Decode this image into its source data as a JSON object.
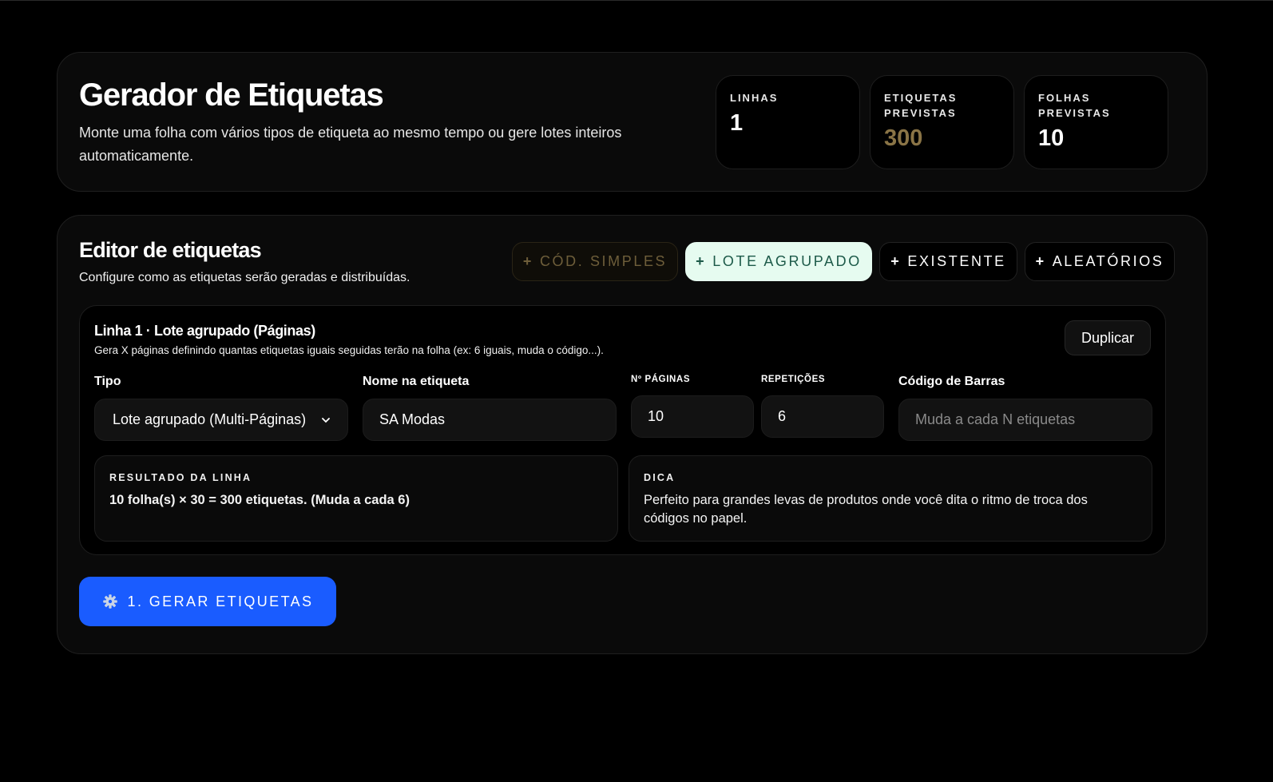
{
  "header": {
    "title": "Gerador de Etiquetas",
    "subtitle": "Monte uma folha com vários tipos de etiqueta ao mesmo tempo ou gere lotes inteiros automaticamente.",
    "stats": [
      {
        "label": "LINHAS",
        "value": "1"
      },
      {
        "label": "ETIQUETAS PREVISTAS",
        "value": "300",
        "color": "#8a7446"
      },
      {
        "label": "FOLHAS PREVISTAS",
        "value": "10"
      }
    ]
  },
  "editor": {
    "title": "Editor de etiquetas",
    "subtitle": "Configure como as etiquetas serão geradas e distribuídas.",
    "add_buttons": [
      {
        "plus": "+",
        "label": "CÓD. SIMPLES",
        "state": "muted"
      },
      {
        "plus": "+",
        "label": "LOTE AGRUPADO",
        "state": "active"
      },
      {
        "plus": "+",
        "label": "EXISTENTE",
        "state": "default"
      },
      {
        "plus": "+",
        "label": "ALEATÓRIOS",
        "state": "default"
      }
    ],
    "line": {
      "title": "Linha 1 · Lote agrupado (Páginas)",
      "description": "Gera X páginas definindo quantas etiquetas iguais seguidas terão na folha (ex: 6 iguais, muda o código...).",
      "duplicate_label": "Duplicar",
      "fields": {
        "tipo": {
          "label": "Tipo",
          "value": "Lote agrupado (Multi-Páginas)"
        },
        "nome": {
          "label": "Nome na etiqueta",
          "value": "SA Modas"
        },
        "paginas": {
          "label": "Nº PÁGINAS",
          "value": "10"
        },
        "repeticoes": {
          "label": "REPETIÇÕES",
          "value": "6"
        },
        "codigo": {
          "label": "Código de Barras",
          "value": "",
          "placeholder": "Muda a cada N etiquetas"
        }
      },
      "result": {
        "label": "RESULTADO DA LINHA",
        "text": "10 folha(s) × 30 = 300 etiquetas. (Muda a cada 6)"
      },
      "tip": {
        "label": "DICA",
        "text": "Perfeito para grandes levas de produtos onde você dita o ritmo de troca dos códigos no papel."
      }
    },
    "generate_label": "1. GERAR ETIQUETAS"
  },
  "colors": {
    "background": "#000000",
    "card": "#0a0a0a",
    "accent_blue": "#1a5cff",
    "active_pill_bg": "#e6fbf0",
    "active_pill_text": "#1d5a49",
    "gold": "#8a7446"
  },
  "icons": {
    "generate": "gear-icon",
    "select": "chevron-down-icon"
  }
}
